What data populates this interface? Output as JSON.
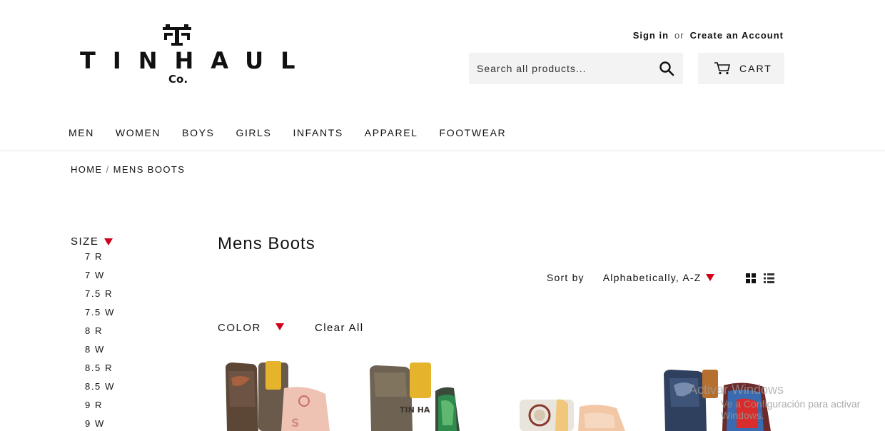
{
  "brand": {
    "name": "TINHAUL",
    "suffix": "Co."
  },
  "header": {
    "sign_in": "Sign in",
    "or": "or",
    "create_account": "Create an Account",
    "search_placeholder": "Search all products...",
    "cart_label": "CART"
  },
  "nav": {
    "items": [
      "MEN",
      "WOMEN",
      "BOYS",
      "GIRLS",
      "INFANTS",
      "APPAREL",
      "FOOTWEAR"
    ]
  },
  "breadcrumb": {
    "home": "HOME",
    "separator": "/",
    "current": "MENS BOOTS"
  },
  "sidebar": {
    "size_title": "SIZE",
    "sizes": [
      "7 R",
      "7 W",
      "7.5 R",
      "7.5 W",
      "8 R",
      "8 W",
      "8.5 R",
      "8.5 W",
      "9 R",
      "9 W"
    ]
  },
  "collection": {
    "title": "Mens Boots",
    "sort_label": "Sort by",
    "sort_value": "Alphabetically, A-Z",
    "color_filter": "COLOR",
    "clear_all": "Clear All"
  },
  "watermark": {
    "line1": "Activar Windows",
    "line2": "Ve a Configuración para activar Windows."
  },
  "colors": {
    "accent_red": "#d0021b",
    "button_bg": "#f3f3f3",
    "text": "#111111"
  }
}
